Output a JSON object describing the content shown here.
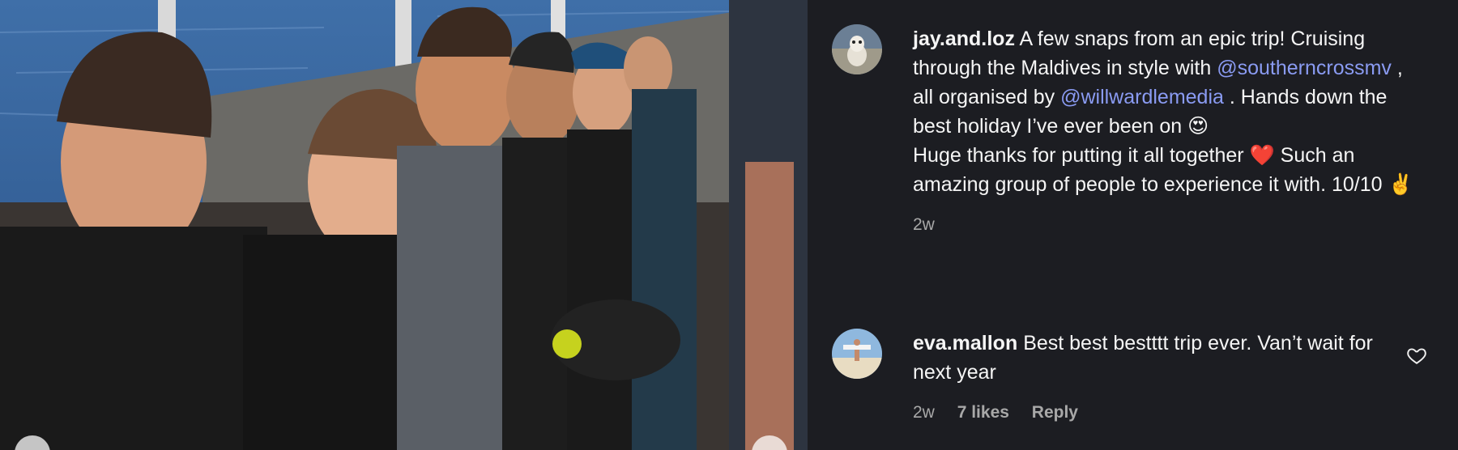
{
  "photo": {
    "description_icon": "group-of-divers-photo",
    "carousel": {
      "prev_icon": "carousel-dot-left",
      "next_icon": "carousel-dot-right"
    }
  },
  "comments": [
    {
      "username": "jay.and.loz",
      "text_1": "A few snaps from an epic trip! Cruising through the Maldives in style with",
      "mention_1": "@southerncrossmv",
      "text_2": ", all organised by",
      "mention_2": "@willwardlemedia",
      "text_3": ". Hands down the best holiday I’ve ever been on",
      "emoji_1": "😍",
      "text_4": "Huge thanks for putting it all together",
      "emoji_2": "❤️",
      "text_5": "Such an amazing group of people to experience it with. 10/10",
      "emoji_3": "✌️",
      "time": "2w"
    },
    {
      "username": "eva.mallon",
      "text": "Best best bestttt trip ever. Van’t wait for next year",
      "time": "2w",
      "likes": "7 likes",
      "reply_label": "Reply",
      "like_icon": "heart-outline-icon"
    }
  ],
  "colors": {
    "background": "#1c1d22",
    "mention": "#8a9bf2",
    "meta": "#a8a8a8"
  }
}
